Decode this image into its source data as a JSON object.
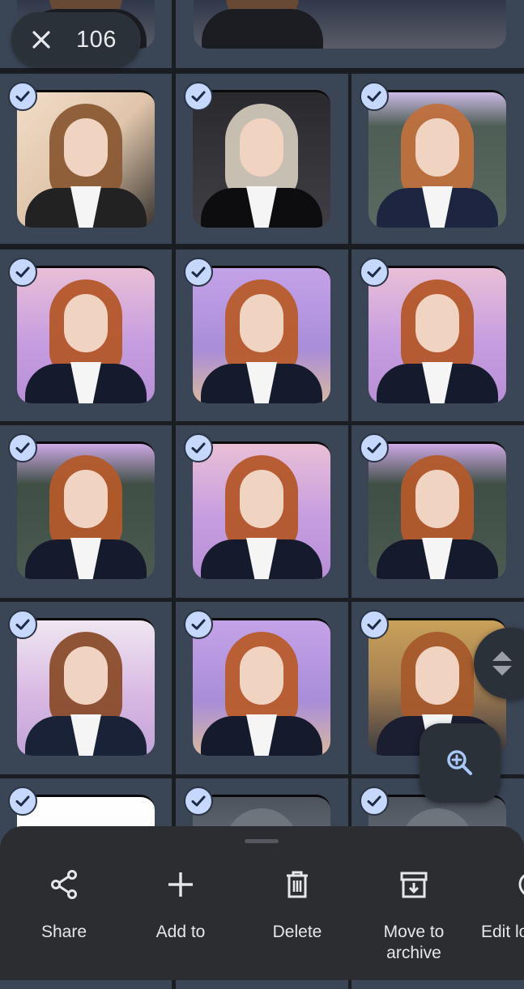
{
  "selection": {
    "count": "106",
    "close_icon": "close-icon"
  },
  "colors": {
    "cell_bg": "#3a4556",
    "check_bg": "#c6d8ff",
    "chrome_bg": "#2b3139",
    "sheet_bg": "#2b2d31",
    "text": "#e6e7ea"
  },
  "grid": {
    "photos": [
      {
        "theme": "dark-poster",
        "selected": true
      },
      {
        "theme": "dark-poster",
        "selected": true
      },
      {
        "theme": "portrait-brown",
        "selected": true
      },
      {
        "theme": "black-suit",
        "selected": true
      },
      {
        "theme": "chalkboard",
        "selected": true
      },
      {
        "theme": "classroom-pink",
        "selected": true
      },
      {
        "theme": "classroom-purple",
        "selected": true
      },
      {
        "theme": "classroom-pink",
        "selected": true
      },
      {
        "theme": "green-board",
        "selected": true
      },
      {
        "theme": "classroom-pink",
        "selected": true
      },
      {
        "theme": "green-board",
        "selected": true
      },
      {
        "theme": "classroom-side",
        "selected": true
      },
      {
        "theme": "classroom-purple",
        "selected": true
      },
      {
        "theme": "bookshelf",
        "selected": true
      },
      {
        "theme": "white",
        "selected": true
      },
      {
        "theme": "grey-blur",
        "selected": true
      },
      {
        "theme": "grey-blur",
        "selected": true
      }
    ]
  },
  "actions": [
    {
      "label": "Share",
      "icon": "share-icon"
    },
    {
      "label": "Add to",
      "icon": "plus-icon"
    },
    {
      "label": "Delete",
      "icon": "trash-icon"
    },
    {
      "label": "Move to archive",
      "icon": "archive-icon"
    },
    {
      "label": "Edit lo",
      "icon": "edit-location-icon"
    }
  ],
  "fabs": {
    "scroll": "scroll-arrows-icon",
    "zoom": "zoom-in-icon"
  }
}
